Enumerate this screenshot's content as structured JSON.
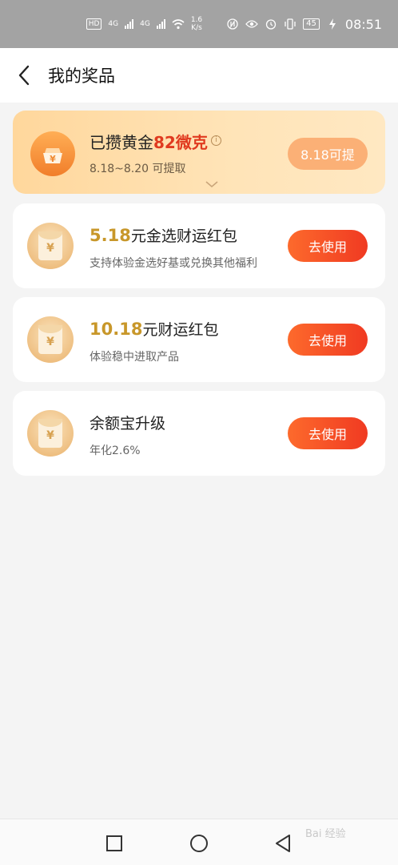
{
  "status_bar": {
    "hd": "HD",
    "net1": "4G",
    "net2": "4G",
    "speed_value": "1.6",
    "speed_unit": "K/s",
    "battery": "45",
    "time": "08:51"
  },
  "header": {
    "back_icon": "chevron-left-icon",
    "title": "我的奖品"
  },
  "gold_card": {
    "title_prefix": "已攒黄金",
    "amount": "82微克",
    "period": "8.18~8.20 可提取",
    "button_label": "8.18可提",
    "icon": "gold-bar-icon"
  },
  "prizes": [
    {
      "amount": "5.18",
      "title": "元金选财运红包",
      "desc": "支持体验金选好基或兑换其他福利",
      "button": "去使用",
      "icon": "red-envelope-icon"
    },
    {
      "amount": "10.18",
      "title": "元财运红包",
      "desc": "体验稳中进取产品",
      "button": "去使用",
      "icon": "red-envelope-icon"
    },
    {
      "amount": "",
      "title": "余额宝升级",
      "desc": "年化2.6%",
      "button": "去使用",
      "icon": "red-envelope-icon"
    }
  ],
  "watermark": "Bai 经验",
  "colors": {
    "accent_red": "#e03a1f",
    "gold_amount": "#c8972a",
    "button_start": "#fd6a2c",
    "button_end": "#f03a22"
  }
}
